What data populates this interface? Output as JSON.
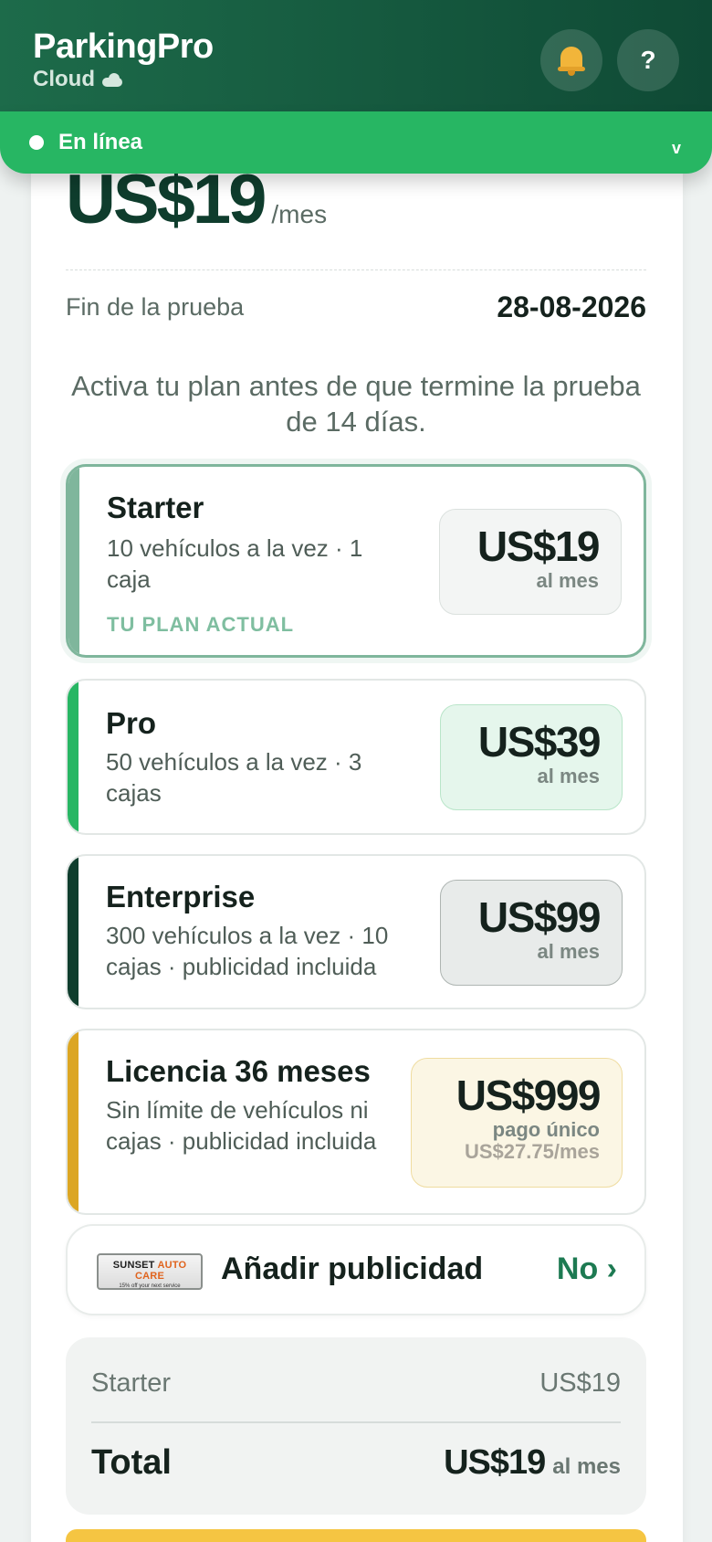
{
  "header": {
    "title": "ParkingPro",
    "subtitle": "Cloud",
    "help_label": "?"
  },
  "status": {
    "label": "En línea",
    "chevron": "v"
  },
  "current_price": {
    "amount": "US$19",
    "period": "/mes"
  },
  "trial": {
    "label": "Fin de la prueba",
    "date": "28-08-2026"
  },
  "activate_note": "Activa tu plan antes de que termine la prueba de 14 días.",
  "plans": [
    {
      "name": "Starter",
      "description": "10 vehículos a la vez · 1 caja",
      "badge": "TU PLAN ACTUAL",
      "price": "US$19",
      "period": "al mes",
      "accent_color": "#7fb69c"
    },
    {
      "name": "Pro",
      "description": "50 vehículos a la vez · 3 cajas",
      "price": "US$39",
      "period": "al mes",
      "accent_color": "#27b663"
    },
    {
      "name": "Enterprise",
      "description": "300 vehículos a la vez · 10 cajas · publicidad incluida",
      "price": "US$99",
      "period": "al mes",
      "accent_color": "#0f3d2d"
    },
    {
      "name": "Licencia 36 meses",
      "description": "Sin límite de vehículos ni cajas · publicidad incluida",
      "price": "US$999",
      "period": "pago único",
      "monthly_equivalent": "US$27.75/mes",
      "accent_color": "#dca623"
    }
  ],
  "advertising": {
    "logo_text_1": "SUNSET",
    "logo_text_2": "AUTO CARE",
    "logo_tagline": "15% off your next service",
    "label": "Añadir publicidad",
    "value": "No ›"
  },
  "summary": {
    "line_item": "Starter",
    "line_amount": "US$19",
    "total_label": "Total",
    "total_amount": "US$19",
    "total_period": "al mes"
  },
  "colors": {
    "brand_dark": "#0f4a35",
    "online_green": "#27b663",
    "cta_yellow": "#f5c542"
  }
}
